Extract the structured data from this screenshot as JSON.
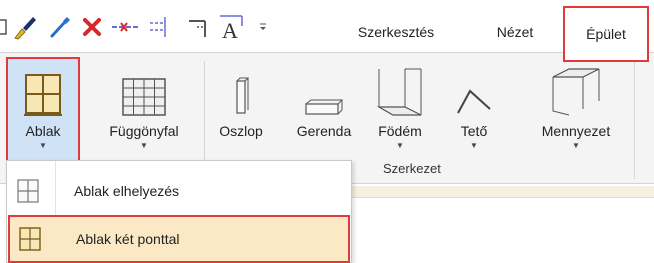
{
  "tabs": {
    "szerkesztes": "Szerkesztés",
    "nezet": "Nézet",
    "epulet": "Épület"
  },
  "ribbon": {
    "buttons": {
      "ablak": "Ablak",
      "fuggonyfal": "Függönyfal",
      "oszlop": "Oszlop",
      "gerenda": "Gerenda",
      "fodem": "Födém",
      "teto": "Tető",
      "mennyezet": "Mennyezet"
    },
    "group_label": "Szerkezet"
  },
  "dropdown": {
    "items": [
      {
        "label": "Ablak elhelyezés"
      },
      {
        "label": "Ablak két ponttal"
      }
    ]
  },
  "colors": {
    "highlight_border": "#e03a3a",
    "selected_item_bg": "#fbe9c6",
    "ribbon_bg": "#f4f4f4"
  },
  "icons": {
    "quick_access": [
      "paintbrush-icon",
      "eyedropper-icon",
      "delete-icon",
      "dimension-icon",
      "align-icon",
      "align-right-icon",
      "text-style-icon",
      "dropdown-arrow-icon"
    ]
  }
}
